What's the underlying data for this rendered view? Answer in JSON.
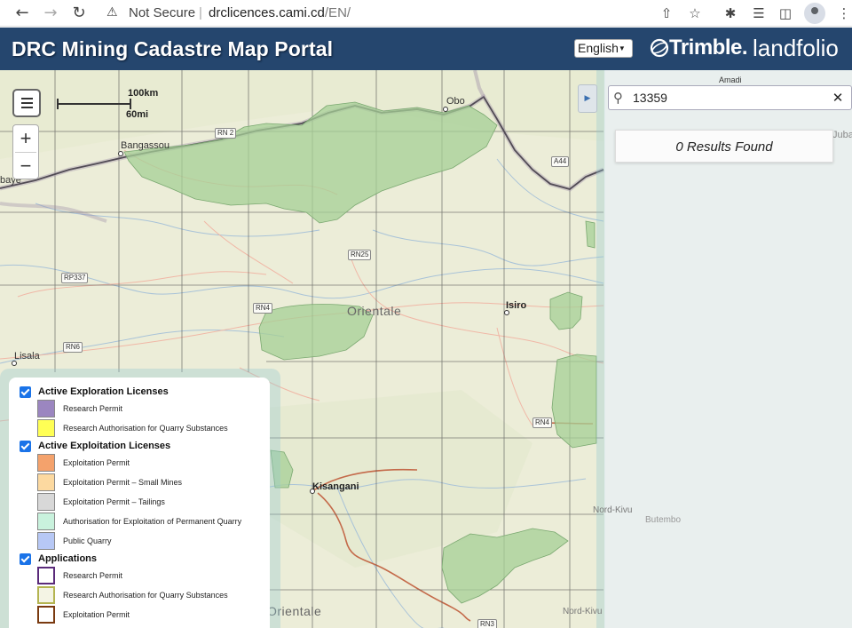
{
  "browser": {
    "security_label": "Not Secure",
    "url_host": "drclicences.cami.cd",
    "url_path": "/EN/"
  },
  "header": {
    "title": "DRC Mining Cadastre Map Portal",
    "language": "English",
    "brand": "Trimble.",
    "product": "landfolio",
    "color": "#25466e"
  },
  "map": {
    "scale": {
      "metric": "100km",
      "imperial": "60mi"
    },
    "labels": {
      "obo": "Obo",
      "bangassou": "Bangassou",
      "baye": "baye",
      "amadi": "Amadi",
      "juba": "Juba",
      "isiro": "Isiro",
      "lisala": "Lisala",
      "kisangani": "Kisangani",
      "orientale_top": "Orientale",
      "orientale_bottom": "Orientale",
      "nord_kivu_1": "Nord-Kivu",
      "nord_kivu_2": "Nord-Kivu",
      "butembo": "Butembo"
    },
    "roads": {
      "rn2": "RN 2",
      "a44": "A44",
      "rn25": "RN25",
      "rp337": "RP337",
      "rn4_a": "RN4",
      "rn6": "RN6",
      "rn4_b": "RN4",
      "rn3": "RN3"
    }
  },
  "search": {
    "value": "13359",
    "results_text": "0 Results Found"
  },
  "legend": {
    "groups": [
      {
        "label": "Active Exploration Licenses",
        "checked": true,
        "items": [
          {
            "label": "Research Permit",
            "color": "#9b86c0"
          },
          {
            "label": "Research Authorisation for Quarry Substances",
            "color": "#ffff55"
          }
        ]
      },
      {
        "label": "Active Exploitation Licenses",
        "checked": true,
        "items": [
          {
            "label": "Exploitation Permit",
            "color": "#f4a26c"
          },
          {
            "label": "Exploitation Permit – Small Mines",
            "color": "#fcd9a0"
          },
          {
            "label": "Exploitation Permit – Tailings",
            "color": "#d8d8d8"
          },
          {
            "label": "Authorisation for Exploitation of Permanent Quarry",
            "color": "#c9f2dd"
          },
          {
            "label": "Public Quarry",
            "color": "#b7c8f5"
          }
        ]
      },
      {
        "label": "Applications",
        "checked": true,
        "items": [
          {
            "label": "Research Permit",
            "color": "#ffffff",
            "border": "#5a2a7a"
          },
          {
            "label": "Research Authorisation for Quarry Substances",
            "color": "#f4f4e4",
            "border": "#b4b450"
          },
          {
            "label": "Exploitation Permit",
            "color": "#ffffff",
            "border": "#7a3a10"
          }
        ]
      }
    ]
  }
}
